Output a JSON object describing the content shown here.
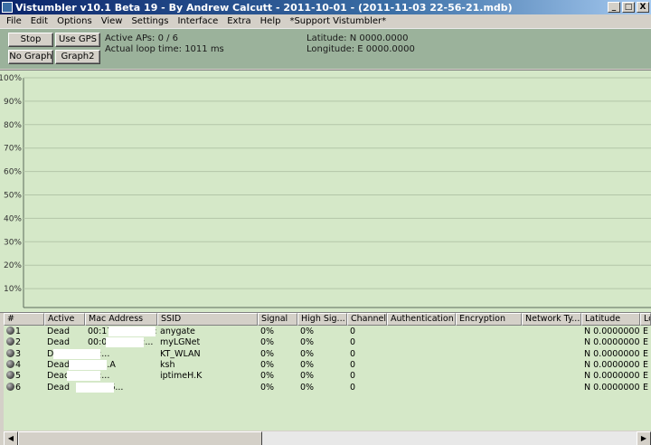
{
  "window": {
    "title": "Vistumbler v10.1 Beta 19 - By Andrew Calcutt - 2011-10-01 - (2011-11-03 22-56-21.mdb)",
    "min_label": "_",
    "max_label": "□",
    "close_label": "X"
  },
  "menu": [
    "File",
    "Edit",
    "Options",
    "View",
    "Settings",
    "Interface",
    "Extra",
    "Help",
    "*Support Vistumbler*"
  ],
  "toolbar": {
    "stop_label": "Stop",
    "use_gps_label": "Use GPS",
    "no_graph_label": "No Graph",
    "graph2_label": "Graph2",
    "active_aps": "Active APs: 0 / 6",
    "loop_time": "Actual loop time: 1011 ms",
    "latitude": "Latitude: N 0000.0000",
    "longitude": "Longitude: E 0000.0000"
  },
  "graph": {
    "y_labels": [
      "100%",
      "90%",
      "80%",
      "70%",
      "60%",
      "50%",
      "40%",
      "30%",
      "20%",
      "10%"
    ]
  },
  "list": {
    "columns": [
      "#",
      "Active",
      "Mac Address",
      "SSID",
      "Signal",
      "High Sig...",
      "Channel",
      "Authentication",
      "Encryption",
      "Network Ty...",
      "Latitude",
      "Lo"
    ],
    "rows": [
      {
        "num": "1",
        "active": "Dead",
        "mac": "00:17:1E:00:FC:...",
        "ssid": "anygate",
        "signal": "0%",
        "high": "0%",
        "channel": "0",
        "lat": "N 0.0000000",
        "lon": "E"
      },
      {
        "num": "2",
        "active": "Dead",
        "mac": "00:02:A8:DB:...",
        "ssid": "myLGNet",
        "signal": "0%",
        "high": "0%",
        "channel": "0",
        "lat": "N 0.0000000",
        "lon": "E"
      },
      {
        "num": "3",
        "active": "Dead",
        "mac": "00:...",
        "ssid": "KT_WLAN",
        "signal": "0%",
        "high": "0%",
        "channel": "0",
        "lat": "N 0.0000000",
        "lon": "E"
      },
      {
        "num": "4",
        "active": "Dead",
        "mac": "00:...A",
        "ssid": "ksh",
        "signal": "0%",
        "high": "0%",
        "channel": "0",
        "lat": "N 0.0000000",
        "lon": "E"
      },
      {
        "num": "5",
        "active": "Dead",
        "mac": "00:...",
        "ssid": "iptimeH.K",
        "signal": "0%",
        "high": "0%",
        "channel": "0",
        "lat": "N 0.0000000",
        "lon": "E"
      },
      {
        "num": "6",
        "active": "Dead",
        "mac": "00:...6...",
        "ssid": "",
        "signal": "0%",
        "high": "0%",
        "channel": "0",
        "lat": "N 0.0000000",
        "lon": "E"
      }
    ]
  },
  "icons": {
    "app": "vistumbler-app-icon",
    "row": "ap-dead-icon",
    "scroll_left": "scroll-left-icon",
    "scroll_right": "scroll-right-icon"
  }
}
